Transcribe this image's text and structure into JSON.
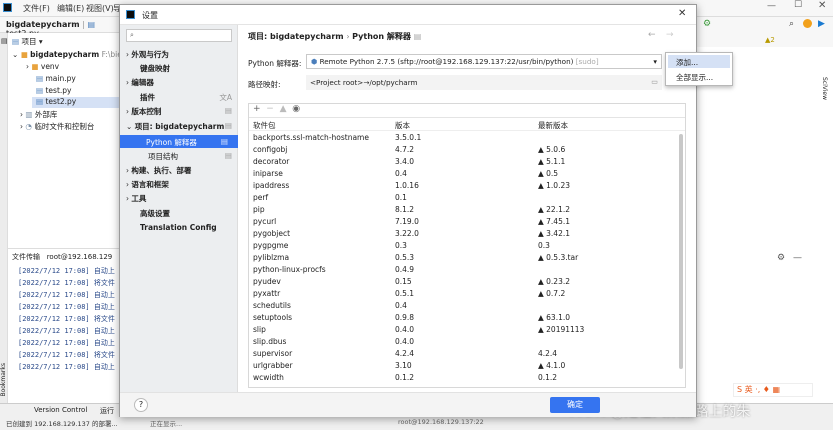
{
  "ide": {
    "menu": [
      "文件(F)",
      "编辑(E)",
      "视图(V)",
      "导"
    ],
    "breadcrumb_project": "bigdatepycharm",
    "breadcrumb_file": "test2.py",
    "project_label": "项目",
    "tree": [
      {
        "label": "bigdatepycharm",
        "note": "F:\\bie"
      },
      {
        "label": "venv"
      },
      {
        "label": "main.py"
      },
      {
        "label": "test.py"
      },
      {
        "label": "test2.py"
      },
      {
        "label": "外部库"
      },
      {
        "label": "临时文件和控制台"
      }
    ],
    "console_tabs": [
      "文件传输",
      "root@192.168.129"
    ],
    "logs": [
      "[2022/7/12 17:08] 自动上",
      "[2022/7/12 17:08] 将文件",
      "[2022/7/12 17:08] 自动上",
      "[2022/7/12 17:08] 自动上",
      "[2022/7/12 17:08] 将文件",
      "[2022/7/12 17:08] 自动上",
      "[2022/7/12 17:08] 自动上",
      "[2022/7/12 17:08] 将文件",
      "[2022/7/12 17:08] 自动上"
    ],
    "status_left": "已创建到 192.168.129.137 的部署...",
    "status_mid": "正在显示...",
    "status_right": "root@192.168.129.137:22",
    "bottom_tabs": [
      "Version Control",
      "运行"
    ],
    "warning_count": "▲2",
    "sciview": "SciView",
    "bookmarks": "Bookmarks",
    "watermark": "CSDN @走在大数据路上的朱"
  },
  "dialog": {
    "title": "设置",
    "search_placeholder": "",
    "sidebar": [
      "外观与行为",
      "键盘映射",
      "编辑器",
      "插件",
      "版本控制",
      "项目: bigdatepycharm",
      "Python 解释器",
      "项目结构",
      "构建、执行、部署",
      "语言和框架",
      "工具",
      "高级设置",
      "Translation Config"
    ],
    "breadcrumb": [
      "项目: bigdatepycharm",
      "Python 解释器"
    ],
    "interpreter_label": "Python 解释器:",
    "interpreter_value": "Remote Python 2.7.5 (sftp://root@192.168.129.137:22/usr/bin/python)",
    "interpreter_suffix": "[sudo]",
    "path_label": "路径映射:",
    "path_value": "<Project root>→/opt/pycharm",
    "columns": [
      "软件包",
      "版本",
      "最新版本"
    ],
    "packages": [
      {
        "name": "backports.ssl-match-hostname",
        "version": "3.5.0.1",
        "latest": ""
      },
      {
        "name": "configobj",
        "version": "4.7.2",
        "latest": "▲ 5.0.6"
      },
      {
        "name": "decorator",
        "version": "3.4.0",
        "latest": "▲ 5.1.1"
      },
      {
        "name": "iniparse",
        "version": "0.4",
        "latest": "▲ 0.5"
      },
      {
        "name": "ipaddress",
        "version": "1.0.16",
        "latest": "▲ 1.0.23"
      },
      {
        "name": "perf",
        "version": "0.1",
        "latest": ""
      },
      {
        "name": "pip",
        "version": "8.1.2",
        "latest": "▲ 22.1.2"
      },
      {
        "name": "pycurl",
        "version": "7.19.0",
        "latest": "▲ 7.45.1"
      },
      {
        "name": "pygobject",
        "version": "3.22.0",
        "latest": "▲ 3.42.1"
      },
      {
        "name": "pygpgme",
        "version": "0.3",
        "latest": "0.3"
      },
      {
        "name": "pyliblzma",
        "version": "0.5.3",
        "latest": "▲ 0.5.3.tar"
      },
      {
        "name": "python-linux-procfs",
        "version": "0.4.9",
        "latest": ""
      },
      {
        "name": "pyudev",
        "version": "0.15",
        "latest": "▲ 0.23.2"
      },
      {
        "name": "pyxattr",
        "version": "0.5.1",
        "latest": "▲ 0.7.2"
      },
      {
        "name": "schedutils",
        "version": "0.4",
        "latest": ""
      },
      {
        "name": "setuptools",
        "version": "0.9.8",
        "latest": "▲ 63.1.0"
      },
      {
        "name": "slip",
        "version": "0.4.0",
        "latest": "▲ 20191113"
      },
      {
        "name": "slip.dbus",
        "version": "0.4.0",
        "latest": ""
      },
      {
        "name": "supervisor",
        "version": "4.2.4",
        "latest": "4.2.4"
      },
      {
        "name": "urlgrabber",
        "version": "3.10",
        "latest": "▲ 4.1.0"
      },
      {
        "name": "wcwidth",
        "version": "0.1.2",
        "latest": "0.1.2"
      }
    ],
    "help": "?",
    "ok_label": "确定"
  },
  "popup": {
    "items": [
      "添加...",
      "全部显示..."
    ]
  },
  "colors": {
    "accent": "#2f65ca",
    "selection": "#3574f0",
    "folder": "#e8a33d",
    "python": "#4a7ebb"
  }
}
